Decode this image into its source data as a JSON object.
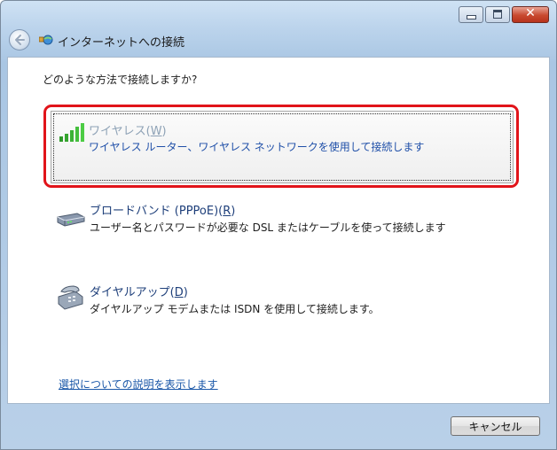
{
  "window": {
    "title": "インターネットへの接続",
    "caption": {
      "minimize_icon": "minimize-icon",
      "maximize_icon": "maximize-icon",
      "close_glyph": "✕"
    }
  },
  "content": {
    "question": "どのような方法で接続しますか?",
    "options": [
      {
        "title_prefix": "ワイヤレス(",
        "hotkey": "W",
        "title_suffix": ")",
        "description": "ワイヤレス ルーター、ワイヤレス ネットワークを使用して接続します",
        "icon": "wireless-signal-icon",
        "selected": true
      },
      {
        "title_prefix": "ブロードバンド (PPPoE)(",
        "hotkey": "R",
        "title_suffix": ")",
        "description": "ユーザー名とパスワードが必要な DSL またはケーブルを使って接続します",
        "icon": "broadband-modem-icon",
        "selected": false
      },
      {
        "title_prefix": "ダイヤルアップ(",
        "hotkey": "D",
        "title_suffix": ")",
        "description": "ダイヤルアップ モデムまたは ISDN を使用して接続します。",
        "icon": "dialup-phone-icon",
        "selected": false
      }
    ],
    "help_link": "選択についての説明を表示します"
  },
  "footer": {
    "cancel_label": "キャンセル"
  },
  "colors": {
    "highlight": "#e1141a",
    "link": "#1a57a8",
    "selected_description": "#1f4fa8"
  }
}
